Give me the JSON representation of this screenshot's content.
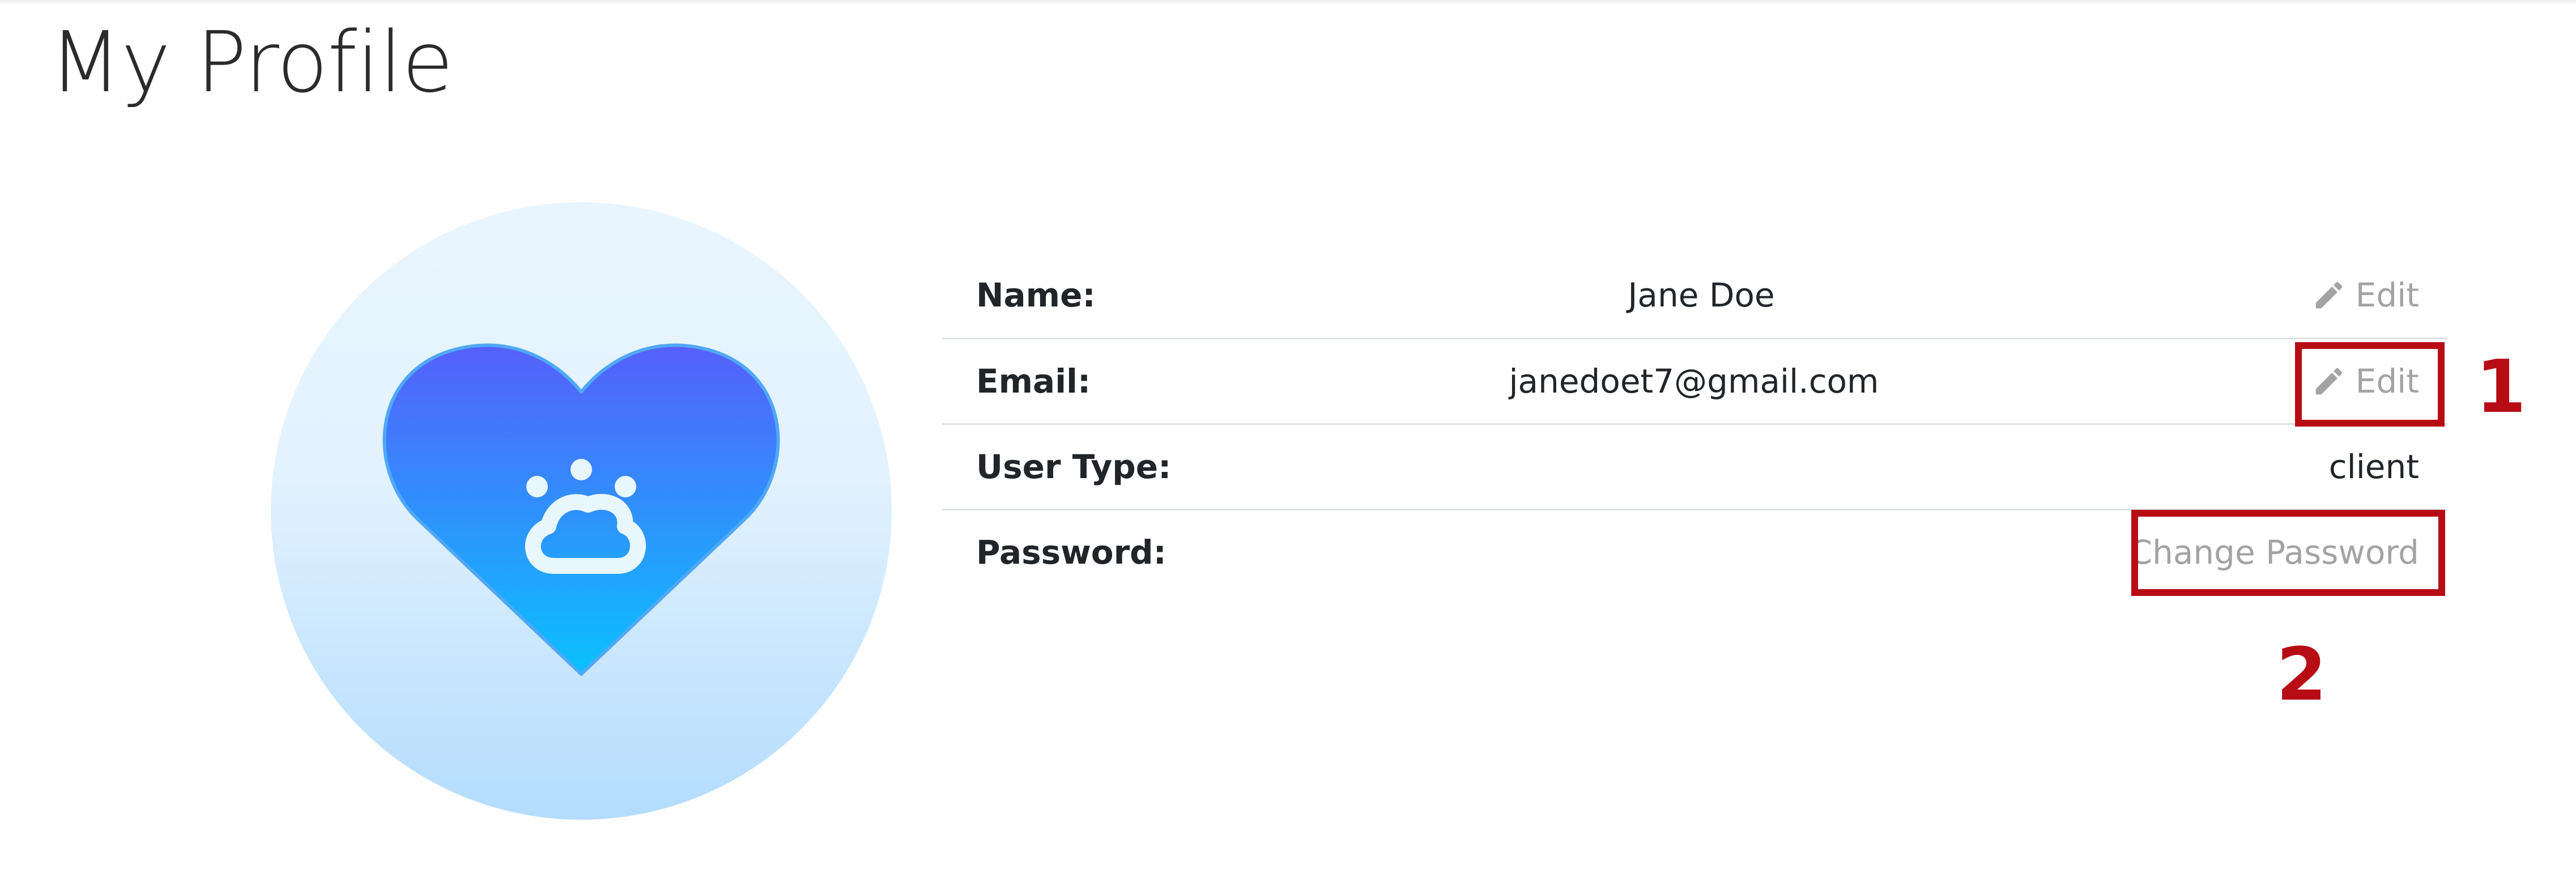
{
  "page": {
    "title": "My Profile"
  },
  "avatar": {
    "icon": "heart-paw-icon"
  },
  "profile": {
    "rows": [
      {
        "label": "Name:",
        "value": "Jane Doe",
        "action": "Edit"
      },
      {
        "label": "Email:",
        "value": "janedoet7@gmail.com",
        "action": "Edit"
      },
      {
        "label": "User Type:",
        "value": "client"
      },
      {
        "label": "Password:",
        "action": "Change Password"
      }
    ]
  },
  "annotations": {
    "callout_1": "1",
    "callout_2": "2"
  },
  "colors": {
    "callout": "#b70c14",
    "muted_action": "#a3a3a3",
    "heart_top": "#5560fb",
    "heart_bottom": "#0ac1fd",
    "avatar_bg": "#e2f2fe"
  }
}
